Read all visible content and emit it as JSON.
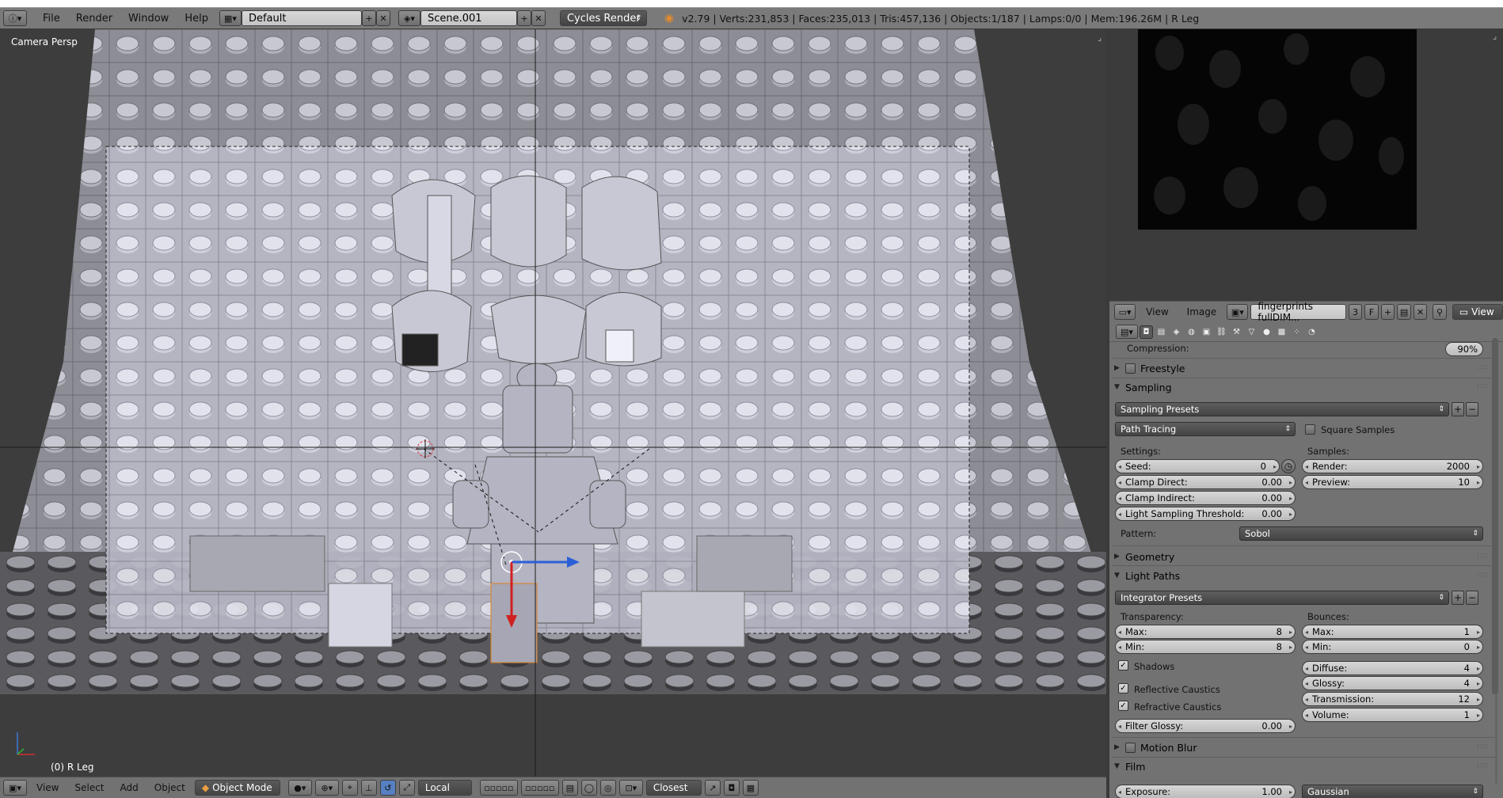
{
  "topbar": {
    "menus": [
      "File",
      "Render",
      "Window",
      "Help"
    ],
    "screen_layout": "Default",
    "scene": "Scene.001",
    "render_engine": "Cycles Render",
    "stats": "v2.79 | Verts:231,853 | Faces:235,013 | Tris:457,136 | Objects:1/187 | Lamps:0/0 | Mem:196.26M | R Leg"
  },
  "viewport": {
    "view_label": "Camera Persp",
    "selected_label": "(0) R Leg"
  },
  "viewport_footer": {
    "menus": [
      "View",
      "Select",
      "Add",
      "Object"
    ],
    "mode": "Object Mode",
    "orientation": "Local",
    "snap_target": "Closest"
  },
  "image_editor": {
    "menus": [
      "View",
      "Image"
    ],
    "image_name": "fingerprints fullDIM...",
    "users": "3",
    "fake_user": "F",
    "view_label": "View"
  },
  "properties": {
    "compression_label": "Compression:",
    "compression_value": "90%",
    "freestyle": "Freestyle",
    "sampling": {
      "title": "Sampling",
      "presets": "Sampling Presets",
      "integrator": "Path Tracing",
      "square_samples": "Square Samples",
      "settings_label": "Settings:",
      "samples_label": "Samples:",
      "seed_label": "Seed:",
      "seed": "0",
      "clamp_direct_label": "Clamp Direct:",
      "clamp_direct": "0.00",
      "clamp_indirect_label": "Clamp Indirect:",
      "clamp_indirect": "0.00",
      "light_threshold_label": "Light Sampling Threshold:",
      "light_threshold": "0.00",
      "render_label": "Render:",
      "render": "2000",
      "preview_label": "Preview:",
      "preview": "10",
      "pattern_label": "Pattern:",
      "pattern": "Sobol"
    },
    "geometry": "Geometry",
    "light_paths": {
      "title": "Light Paths",
      "presets": "Integrator Presets",
      "transparency_label": "Transparency:",
      "bounces_label": "Bounces:",
      "t_max_label": "Max:",
      "t_max": "8",
      "t_min_label": "Min:",
      "t_min": "8",
      "b_max_label": "Max:",
      "b_max": "1",
      "b_min_label": "Min:",
      "b_min": "0",
      "shadows": "Shadows",
      "reflective_caustics": "Reflective Caustics",
      "refractive_caustics": "Refractive Caustics",
      "filter_glossy_label": "Filter Glossy:",
      "filter_glossy": "0.00",
      "diffuse_label": "Diffuse:",
      "diffuse": "4",
      "glossy_label": "Glossy:",
      "glossy": "4",
      "transmission_label": "Transmission:",
      "transmission": "12",
      "volume_label": "Volume:",
      "volume": "1"
    },
    "motion_blur": "Motion Blur",
    "film": {
      "title": "Film",
      "exposure_label": "Exposure:",
      "exposure": "1.00",
      "filter": "Gaussian"
    }
  }
}
